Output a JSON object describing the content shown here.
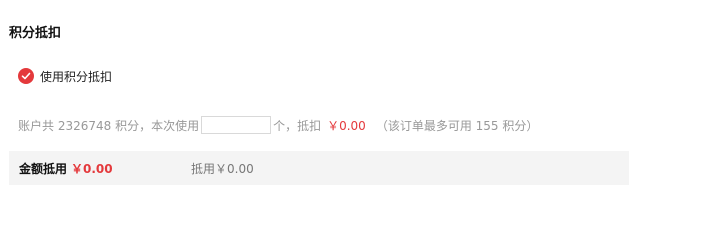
{
  "section": {
    "title": "积分抵扣"
  },
  "use_points": {
    "checked": true,
    "label": "使用积分抵扣"
  },
  "points_row": {
    "account_text": "账户共 2326748 积分，本次使用",
    "input_value": "",
    "unit_text": "个，抵扣",
    "deduct_amount": "￥0.00",
    "max_note": "（该订单最多可用 155 积分）"
  },
  "summary": {
    "label": "金额抵用",
    "amount": "￥0.00",
    "deduct_text": "抵用￥0.00"
  },
  "colors": {
    "accent": "#e4393c",
    "muted_text": "#999999",
    "summary_bg": "#f4f4f4"
  },
  "icons": {
    "check": "check-circle-icon"
  }
}
